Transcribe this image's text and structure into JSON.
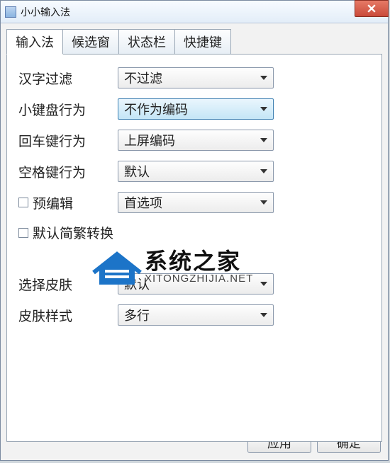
{
  "window": {
    "title": "小小输入法"
  },
  "tabs": [
    {
      "label": "输入法",
      "active": true
    },
    {
      "label": "候选窗",
      "active": false
    },
    {
      "label": "状态栏",
      "active": false
    },
    {
      "label": "快捷键",
      "active": false
    }
  ],
  "fields": {
    "hanzi_filter": {
      "label": "汉字过滤",
      "value": "不过滤"
    },
    "numpad_behavior": {
      "label": "小键盘行为",
      "value": "不作为编码",
      "highlight": true
    },
    "enter_behavior": {
      "label": "回车键行为",
      "value": "上屏编码"
    },
    "space_behavior": {
      "label": "空格键行为",
      "value": "默认"
    },
    "preedit": {
      "label": "预编辑",
      "value": "首选项",
      "checkbox": true
    },
    "simp_trad": {
      "label": "默认简繁转换",
      "checkbox": true
    },
    "skin_select": {
      "label": "选择皮肤",
      "value": "默认"
    },
    "skin_style": {
      "label": "皮肤样式",
      "value": "多行"
    }
  },
  "buttons": {
    "apply": "应用",
    "ok": "确定"
  },
  "watermark": {
    "cn": "系统之家",
    "en": "XITONGZHIJIA.NET"
  }
}
